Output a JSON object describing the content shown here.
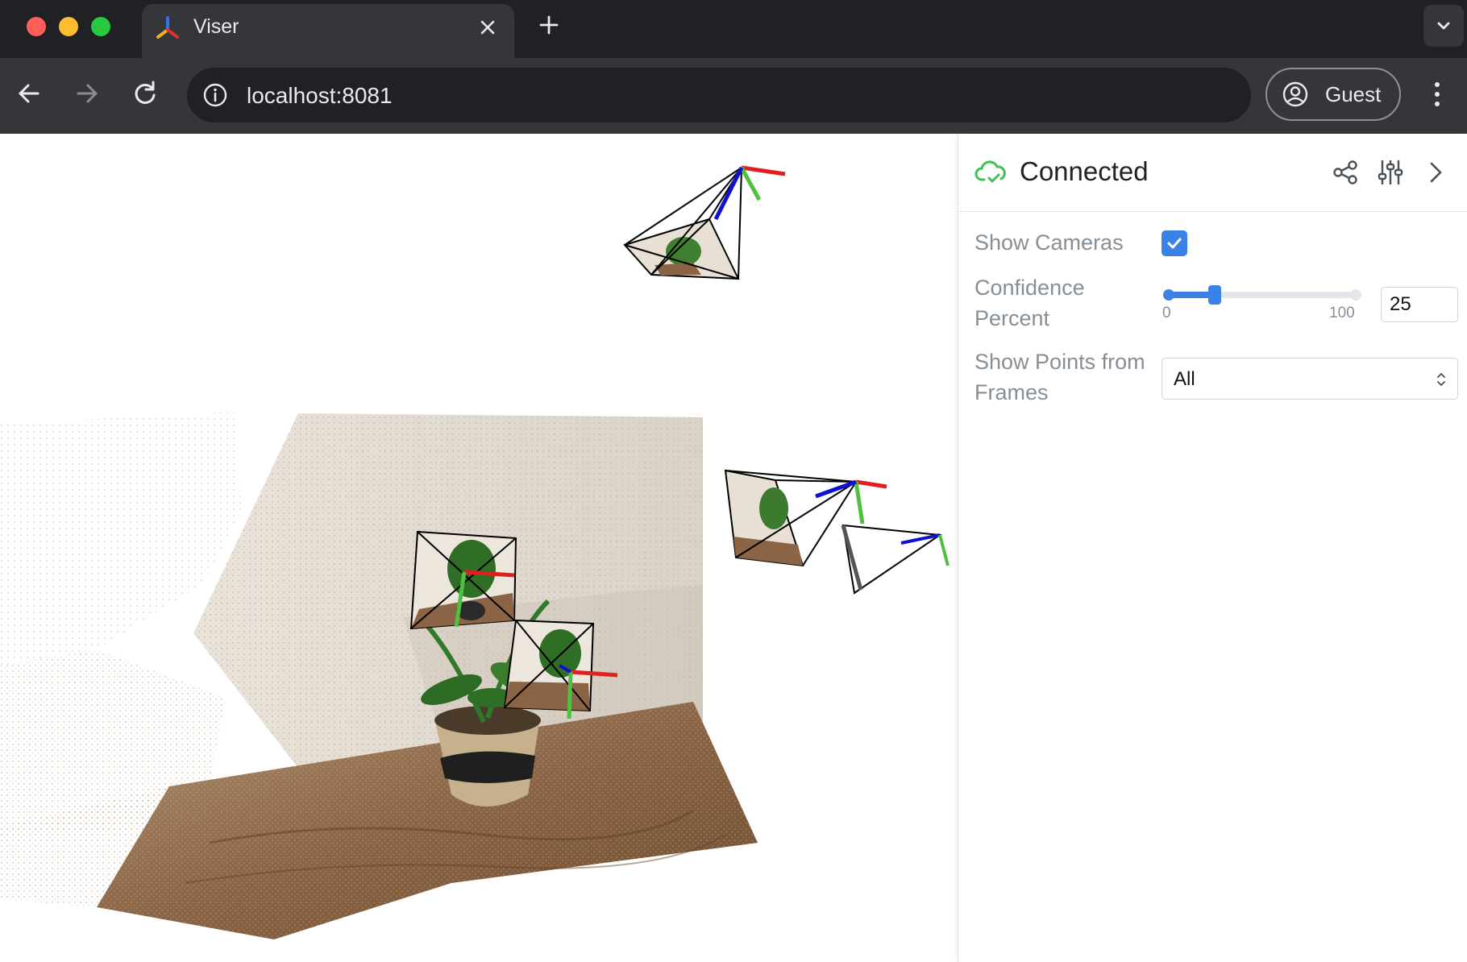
{
  "browser": {
    "tab_title": "Viser",
    "url": "localhost:8081",
    "profile_label": "Guest",
    "traffic_lights": [
      "#ff5f57",
      "#febc2e",
      "#28c840"
    ]
  },
  "panel": {
    "status": "Connected",
    "status_color": "#40c057",
    "accent": "#3b82e6",
    "controls": {
      "show_cameras": {
        "label": "Show Cameras",
        "checked": true
      },
      "confidence": {
        "label_line1": "Confidence",
        "label_line2": "Percent",
        "min": "0",
        "max": "100",
        "value": "25"
      },
      "show_points": {
        "label_line1": "Show Points from",
        "label_line2": "Frames",
        "selected": "All"
      }
    },
    "header_icons": [
      "share-icon",
      "sliders-icon",
      "chevron-right-icon"
    ]
  },
  "viewport": {
    "axis_colors": {
      "x": "#e02020",
      "y": "#50c040",
      "z": "#1010d0"
    }
  }
}
